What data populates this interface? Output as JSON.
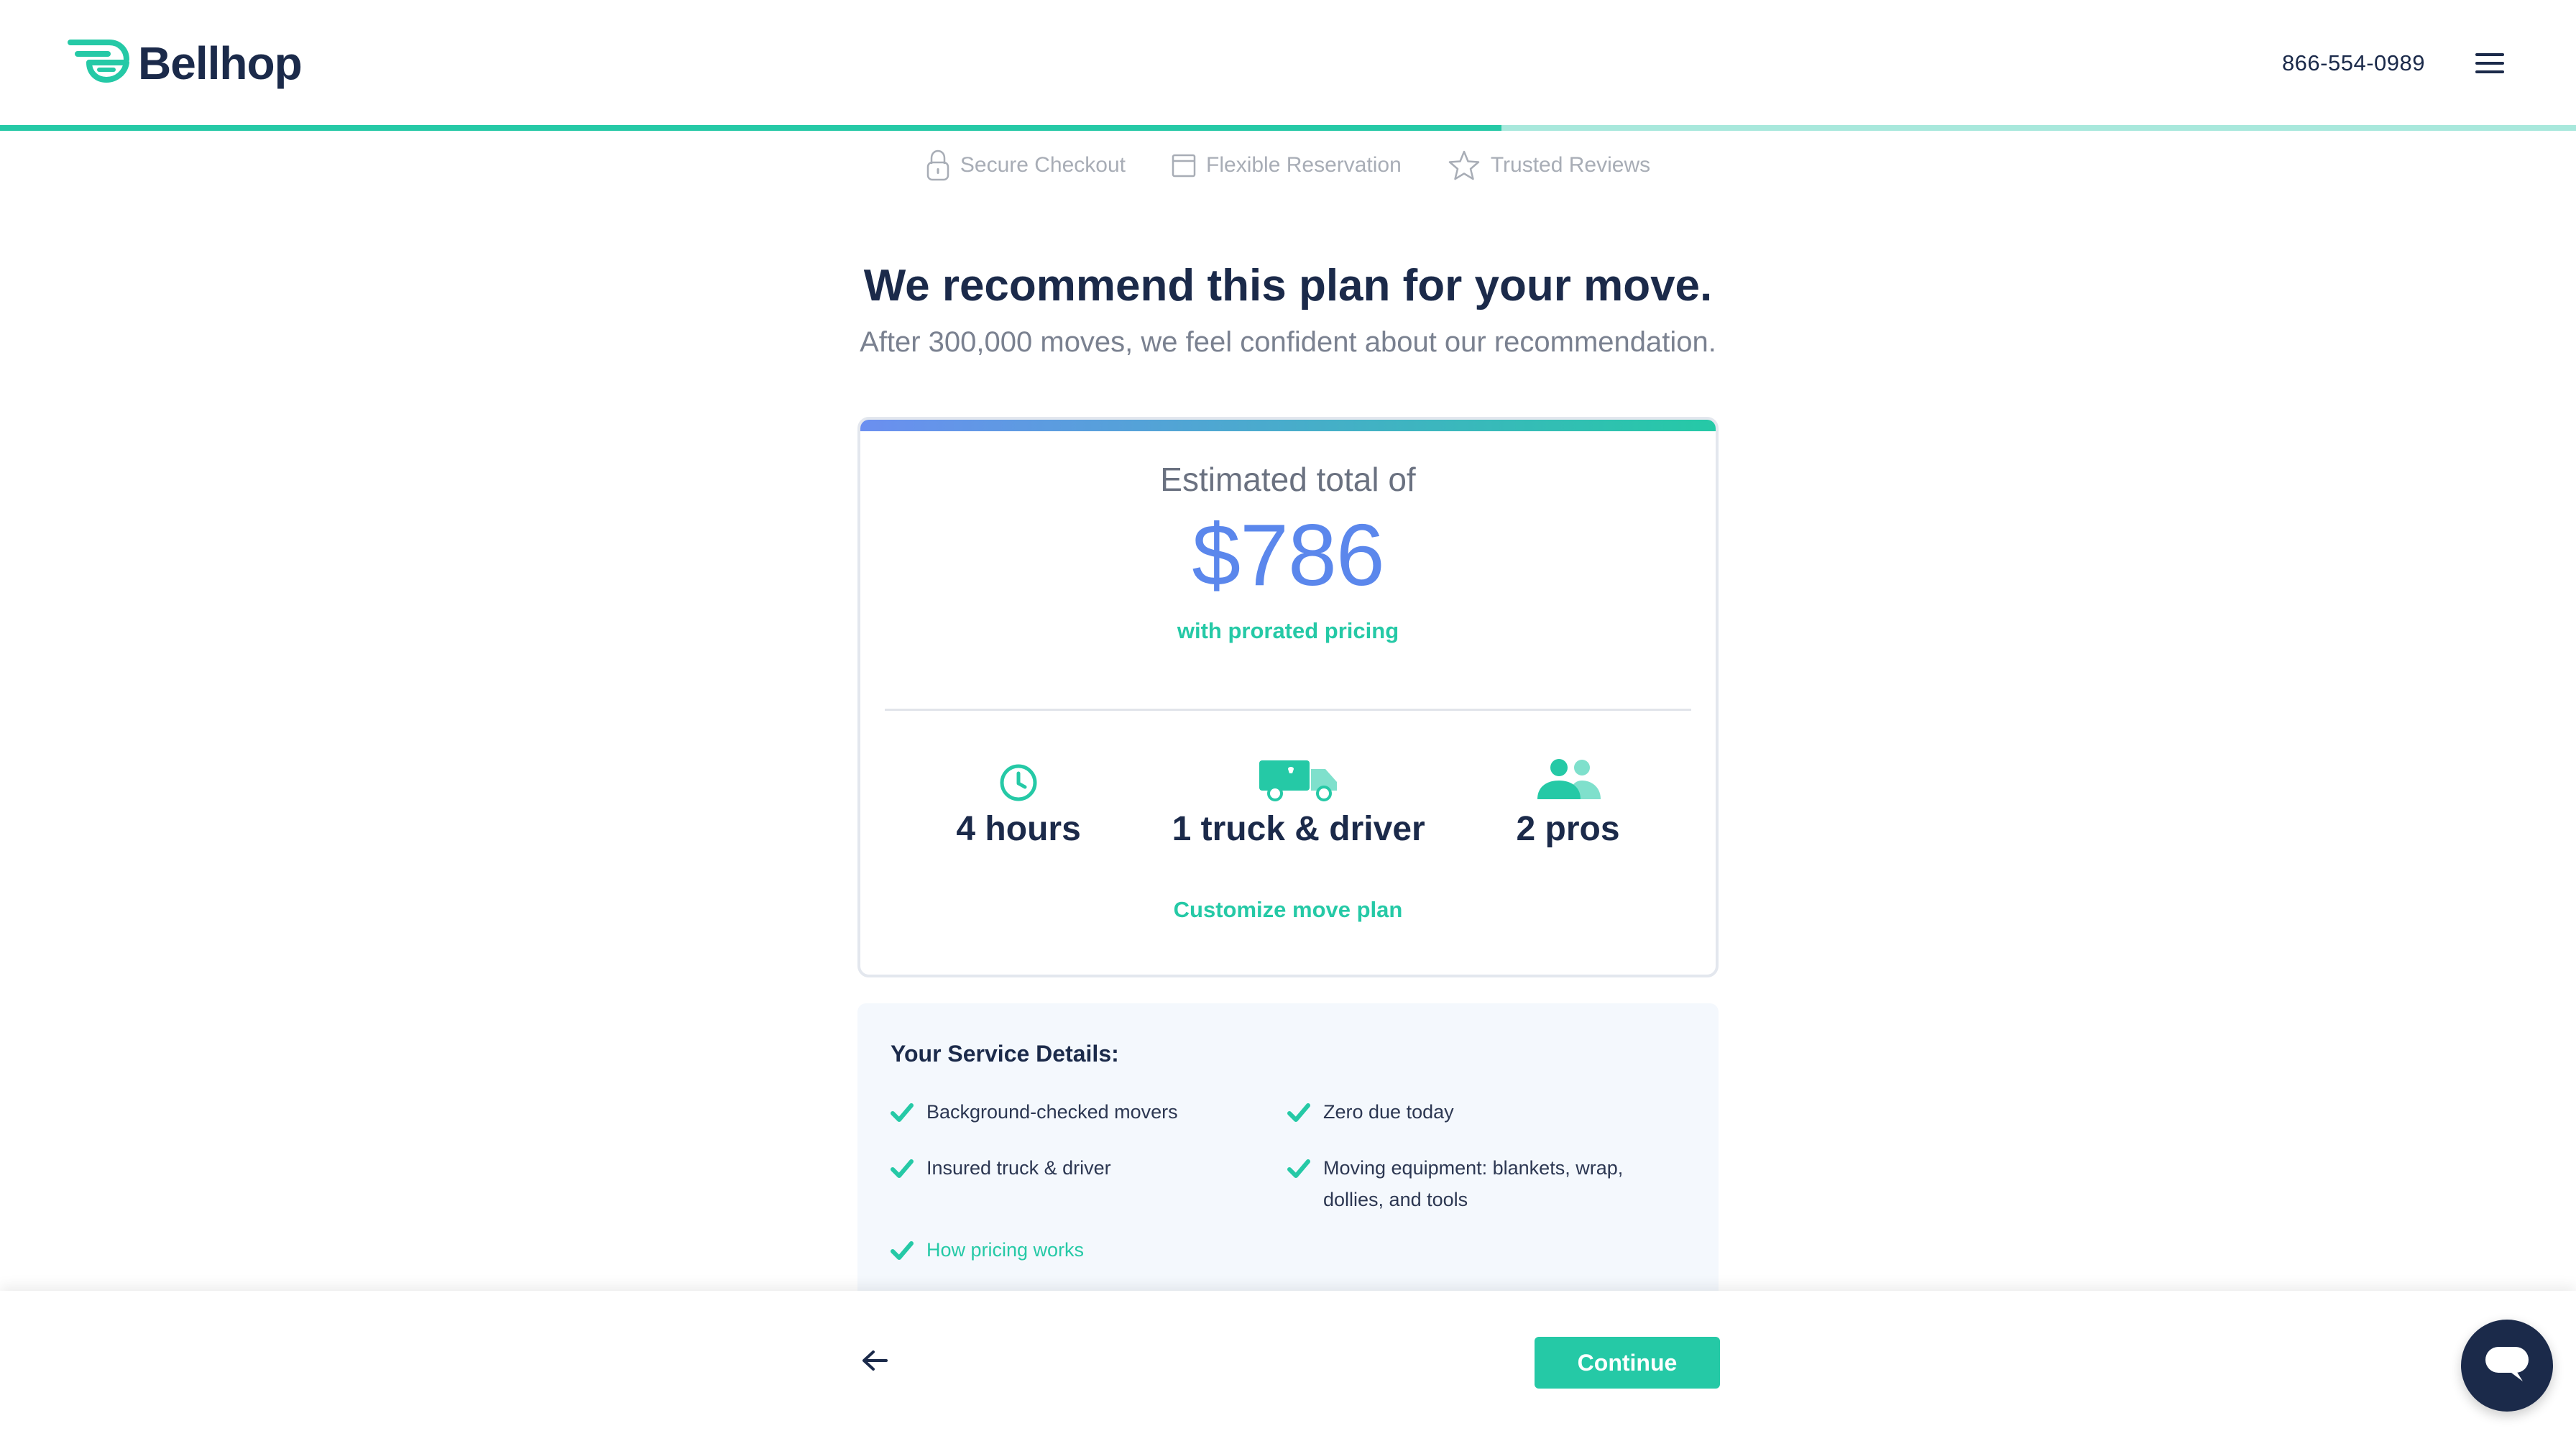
{
  "brand": {
    "name": "Bellhop",
    "logo_icon": "bellhop-logo-icon",
    "accent_color": "#25c9a6",
    "navy": "#1b2a4a",
    "price_color": "#5b87ec"
  },
  "header": {
    "phone": "866-554-0989",
    "menu_icon": "hamburger-menu-icon"
  },
  "progress": {
    "fraction": 0.583
  },
  "trust": [
    {
      "icon": "lock-icon",
      "label": "Secure Checkout"
    },
    {
      "icon": "calendar-icon",
      "label": "Flexible Reservation"
    },
    {
      "icon": "star-icon",
      "label": "Trusted Reviews"
    }
  ],
  "main": {
    "headline": "We recommend this plan for your move.",
    "subhead": "After 300,000 moves, we feel confident about our recommendation."
  },
  "plan": {
    "estimated_label": "Estimated total of",
    "price": "$786",
    "pricing_note": "with prorated pricing",
    "features": [
      {
        "icon": "clock-icon",
        "label": "4 hours"
      },
      {
        "icon": "truck-icon",
        "label": "1 truck & driver"
      },
      {
        "icon": "people-icon",
        "label": "2 pros"
      }
    ],
    "customize_label": "Customize move plan"
  },
  "service": {
    "title": "Your Service Details:",
    "items": [
      "Background-checked movers",
      "Zero due today",
      "Insured truck & driver",
      "Moving equipment: blankets, wrap, dollies, and tools"
    ],
    "pricing_link": "How pricing works"
  },
  "footer": {
    "back_icon": "arrow-left-icon",
    "continue_label": "Continue",
    "chat_icon": "chat-bubble-icon"
  }
}
